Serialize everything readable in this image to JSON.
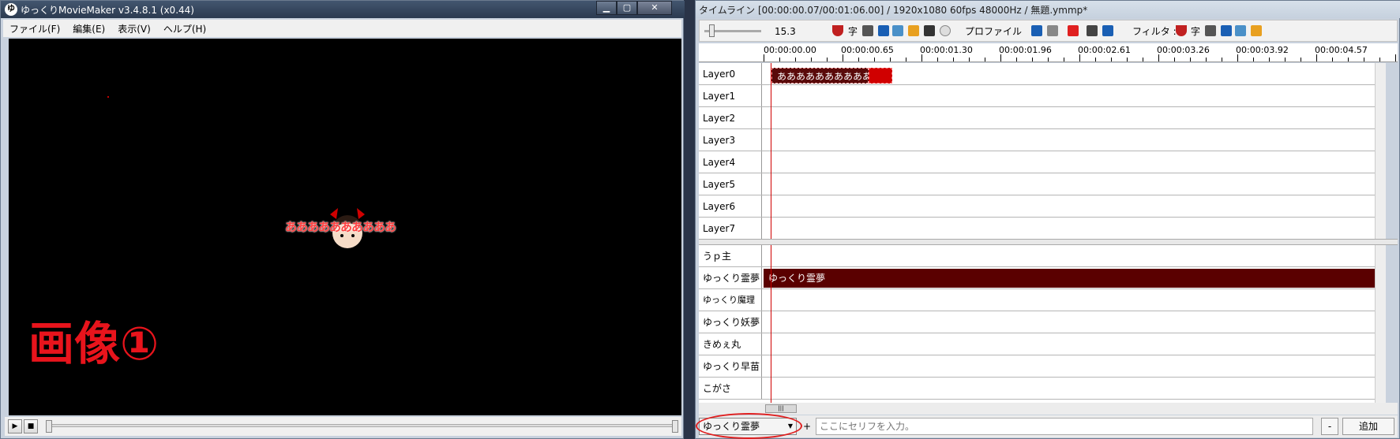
{
  "left_window": {
    "title": "ゆっくりMovieMaker v3.4.8.1 (x0.44)",
    "app_icon": "ゆ",
    "menu": [
      "ファイル(F)",
      "編集(E)",
      "表示(V)",
      "ヘルプ(H)"
    ],
    "preview_text": "ああああああああああ",
    "annotation": "画像①",
    "play_icon": "▶",
    "stop_icon": "■"
  },
  "window_buttons": {
    "minimize": "▁",
    "maximize": "▢",
    "close": "✕"
  },
  "right_window": {
    "title": "タイムライン [00:00:00.07/00:01:06.00] / 1920x1080 60fps 48000Hz / 無題.ymmp*",
    "zoom_value": "15.3",
    "toolbar": {
      "char_label": "字",
      "profile_label": "プロファイル",
      "filter_label": "フィルタ :"
    },
    "ruler_ticks": [
      "00:00:00.00",
      "00:00:00.65",
      "00:00:01.30",
      "00:00:01.96",
      "00:00:02.61",
      "00:00:03.26",
      "00:00:03.92",
      "00:00:04.57"
    ],
    "layers": [
      "Layer0",
      "Layer1",
      "Layer2",
      "Layer3",
      "Layer4",
      "Layer5",
      "Layer6",
      "Layer7"
    ],
    "layer0_clip": "ああああああああああ",
    "voices": [
      "うｐ主",
      "ゆっくり霊夢",
      "ゆっくり魔理沙",
      "ゆっくり妖夢",
      "きめぇ丸",
      "ゆっくり早苗",
      "こがさ"
    ],
    "voice_clip": "ゆっくり霊夢",
    "bottom": {
      "selected_character": "ゆっくり霊夢",
      "plus": "+",
      "input_placeholder": "ここにセリフを入力。",
      "minus": "-",
      "add": "追加"
    }
  },
  "colors": {
    "clip_dark_red": "#5a0000",
    "accent_red": "#d00000",
    "annotation_red": "#e8141c"
  }
}
